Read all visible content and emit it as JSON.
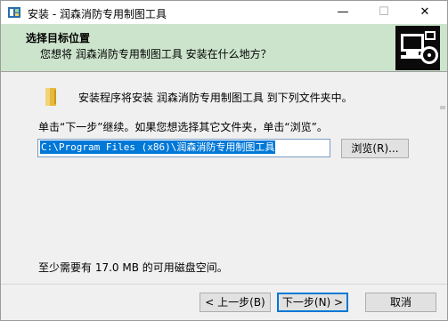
{
  "window": {
    "title": "安装 - 润森消防专用制图工具",
    "minimize_glyph": "—",
    "maximize_glyph": "☐",
    "close_glyph": "✕"
  },
  "header": {
    "title": "选择目标位置",
    "subtitle": "您想将 润森消防专用制图工具 安装在什么地方？"
  },
  "body": {
    "install_line": "安装程序将安装 润森消防专用制图工具 到下列文件夹中。",
    "instruction": "单击“下一步”继续。如果您想选择其它文件夹，单击“浏览”。",
    "path_value": "C:\\Program Files (x86)\\润森消防专用制图工具",
    "browse_label": "浏览(R)...",
    "disk_space": "至少需要有 17.0 MB 的可用磁盘空间。"
  },
  "footer": {
    "back_label": "< 上一步(B)",
    "next_label": "下一步(N) >",
    "cancel_label": "取消"
  },
  "colors": {
    "header_bg": "#cce4cc",
    "selection": "#0078d7",
    "default_button_border": "#0078d7"
  }
}
